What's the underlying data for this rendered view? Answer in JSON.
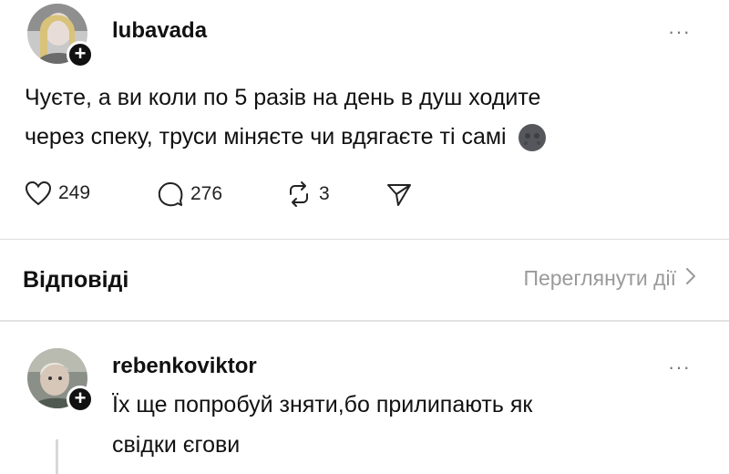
{
  "post": {
    "username": "lubavada",
    "text_line1": "Чуєте, а ви коли по 5 разів на день в душ ходите",
    "text_line2": "через спеку, труси міняєте чи вдягаєте ті самі",
    "more_label": "···",
    "follow_label": "+",
    "stats": {
      "likes": "249",
      "comments": "276",
      "reposts": "3"
    },
    "icons": [
      "heart-icon",
      "comment-icon",
      "repost-icon",
      "share-icon",
      "moon-emoji-icon"
    ]
  },
  "replies_section": {
    "title": "Відповіді",
    "view_actions": "Переглянути дії"
  },
  "reply": {
    "username": "rebenkoviktor",
    "text_line1": "Їх ще попробуй зняти,бо прилипають як",
    "text_line2": "свідки єгови",
    "more_label": "···",
    "follow_label": "+"
  },
  "colors": {
    "text": "#111111",
    "muted": "#9a9a9a",
    "divider": "#dedede"
  }
}
